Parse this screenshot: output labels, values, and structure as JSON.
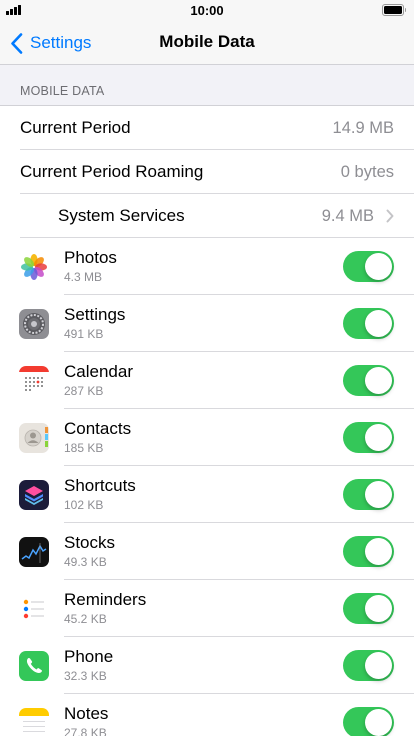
{
  "status_bar": {
    "time": "10:00"
  },
  "nav": {
    "back_label": "Settings",
    "title": "Mobile Data"
  },
  "section": {
    "header": "MOBILE DATA"
  },
  "summary": [
    {
      "label": "Current Period",
      "value": "14.9 MB"
    },
    {
      "label": "Current Period Roaming",
      "value": "0 bytes"
    },
    {
      "label": "System Services",
      "value": "9.4 MB"
    }
  ],
  "apps": [
    {
      "name": "Photos",
      "size": "4.3 MB",
      "icon": "photos-icon",
      "enabled": true
    },
    {
      "name": "Settings",
      "size": "491 KB",
      "icon": "settings-icon",
      "enabled": true
    },
    {
      "name": "Calendar",
      "size": "287 KB",
      "icon": "calendar-icon",
      "enabled": true
    },
    {
      "name": "Contacts",
      "size": "185 KB",
      "icon": "contacts-icon",
      "enabled": true
    },
    {
      "name": "Shortcuts",
      "size": "102 KB",
      "icon": "shortcuts-icon",
      "enabled": true
    },
    {
      "name": "Stocks",
      "size": "49.3 KB",
      "icon": "stocks-icon",
      "enabled": true
    },
    {
      "name": "Reminders",
      "size": "45.2 KB",
      "icon": "reminders-icon",
      "enabled": true
    },
    {
      "name": "Phone",
      "size": "32.3 KB",
      "icon": "phone-icon",
      "enabled": true
    },
    {
      "name": "Notes",
      "size": "27.8 KB",
      "icon": "notes-icon",
      "enabled": true
    }
  ],
  "colors": {
    "accent": "#007aff",
    "toggle_on": "#34c759",
    "secondary_text": "#8e8e93"
  }
}
